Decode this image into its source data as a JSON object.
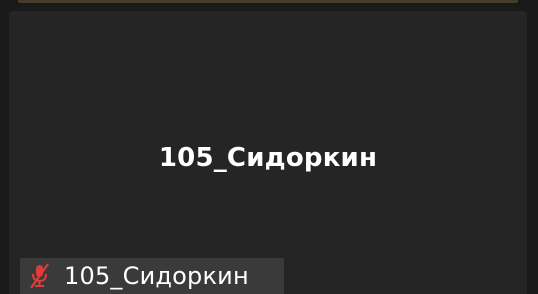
{
  "participant": {
    "display_name": "105_Сидоркин",
    "label_name": "105_Сидоркин",
    "mic_status": "muted",
    "mic_icon": "mic-muted-icon"
  },
  "colors": {
    "background": "#1a1a1a",
    "tile": "#252525",
    "label_bar": "#3a3a3a",
    "text": "#ffffff",
    "muted_icon": "#e03b3b"
  }
}
